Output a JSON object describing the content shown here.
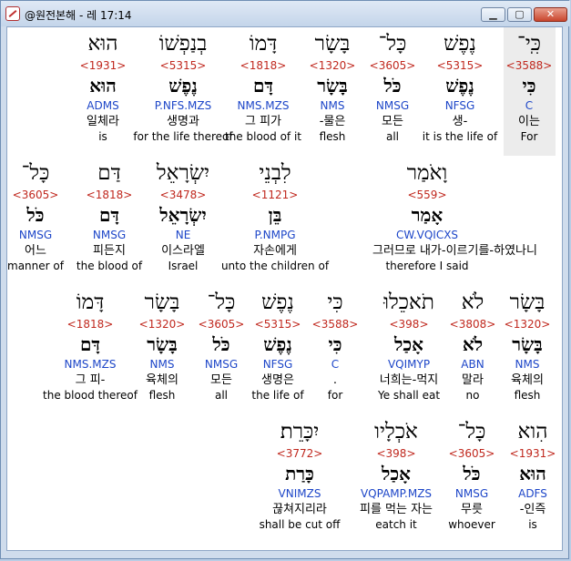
{
  "window": {
    "title": "@원전본해 - 레 17:14",
    "minimize": "▁",
    "maximize": "▢",
    "close": "✕"
  },
  "lines": [
    [
      {
        "heb": "כִּֽי־",
        "strong": "<3588>",
        "lemma": "כִּי",
        "morph": "C",
        "kor": "이는",
        "eng": "For",
        "highlight": true
      },
      {
        "heb": "נֶפֶשׁ",
        "strong": "<5315>",
        "lemma": "נֶפֶשׁ",
        "morph": "NFSG",
        "kor": "생-",
        "eng": "it is the life of"
      },
      {
        "heb": "כָּל־",
        "strong": "<3605>",
        "lemma": "כֹּל",
        "morph": "NMSG",
        "kor": "모든",
        "eng": "all"
      },
      {
        "heb": "בָּשָׂר",
        "strong": "<1320>",
        "lemma": "בָּשָׂר",
        "morph": "NMS",
        "kor": "-물은",
        "eng": "flesh"
      },
      {
        "heb": "דָּמוֹ",
        "strong": "<1818>",
        "lemma": "דָּם",
        "morph": "NMS.MZS",
        "kor": "그 피가",
        "eng": "the blood of it"
      },
      {
        "heb": "בְנַפְשׁוֹ",
        "strong": "<5315>",
        "lemma": "נֶפֶשׁ",
        "morph": "P.NFS.MZS",
        "kor": "생명과",
        "eng": "for the life thereof"
      },
      {
        "heb": "הוּא",
        "strong": "<1931>",
        "lemma": "הוּא",
        "morph": "ADMS",
        "kor": "일체라",
        "eng": "is"
      }
    ],
    [
      {
        "heb": "וָאֹמַר",
        "strong": "<559>",
        "lemma": "אָמַר",
        "morph": "CW.VQICXS",
        "kor": "그러므로 내가-이르기를-하였나니",
        "eng": "therefore I said"
      },
      {
        "heb": "לִבְנֵי",
        "strong": "<1121>",
        "lemma": "בֵּן",
        "morph": "P.NMPG",
        "kor": "자손에게",
        "eng": "unto the children of"
      },
      {
        "heb": "יִשְׂרָאֵל",
        "strong": "<3478>",
        "lemma": "יִשְׂרָאֵל",
        "morph": "NE",
        "kor": "이스라엘",
        "eng": "Israel"
      },
      {
        "heb": "דַּם",
        "strong": "<1818>",
        "lemma": "דָּם",
        "morph": "NMSG",
        "kor": "피든지",
        "eng": "the blood of"
      },
      {
        "heb": "כָּל־",
        "strong": "<3605>",
        "lemma": "כֹּל",
        "morph": "NMSG",
        "kor": "어느",
        "eng": "manner of"
      }
    ],
    [
      {
        "heb": "בָּשָׂר",
        "strong": "<1320>",
        "lemma": "בָּשָׂר",
        "morph": "NMS",
        "kor": "육체의",
        "eng": "flesh"
      },
      {
        "heb": "לֹא",
        "strong": "<3808>",
        "lemma": "לֹא",
        "morph": "ABN",
        "kor": "말라",
        "eng": "no"
      },
      {
        "heb": "תֹאכֵלוּ",
        "strong": "<398>",
        "lemma": "אָכַל",
        "morph": "VQIMYP",
        "kor": "너희는-먹지",
        "eng": "Ye shall eat"
      },
      {
        "heb": "כִּי",
        "strong": "<3588>",
        "lemma": "כִּי",
        "morph": "C",
        "kor": ".",
        "eng": "for"
      },
      {
        "heb": "נֶפֶשׁ",
        "strong": "<5315>",
        "lemma": "נֶפֶשׁ",
        "morph": "NFSG",
        "kor": "생명은",
        "eng": "the life of"
      },
      {
        "heb": "כָּל־",
        "strong": "<3605>",
        "lemma": "כֹּל",
        "morph": "NMSG",
        "kor": "모든",
        "eng": "all"
      },
      {
        "heb": "בָּשָׂר",
        "strong": "<1320>",
        "lemma": "בָּשָׂר",
        "morph": "NMS",
        "kor": "육체의",
        "eng": "flesh"
      },
      {
        "heb": "דָּמוֹ",
        "strong": "<1818>",
        "lemma": "דָּם",
        "morph": "NMS.MZS",
        "kor": "그 피-",
        "eng": "the blood thereof"
      }
    ],
    [
      {
        "heb": "הִוא",
        "strong": "<1931>",
        "lemma": "הוּא",
        "morph": "ADFS",
        "kor": "-인즉",
        "eng": "is"
      },
      {
        "heb": "כָּל־",
        "strong": "<3605>",
        "lemma": "כֹּל",
        "morph": "NMSG",
        "kor": "무릇",
        "eng": "whoever"
      },
      {
        "heb": "אֹכְלָיו",
        "strong": "<398>",
        "lemma": "אָכַל",
        "morph": "VQPAMP.MZS",
        "kor": "피를 먹는 자는",
        "eng": "eatch it"
      },
      {
        "heb": "יִכָּרֵת׃",
        "strong": "<3772>",
        "lemma": "כָּרַת",
        "morph": "VNIMZS",
        "kor": "끊쳐지리라",
        "eng": "shall be cut off"
      }
    ]
  ]
}
